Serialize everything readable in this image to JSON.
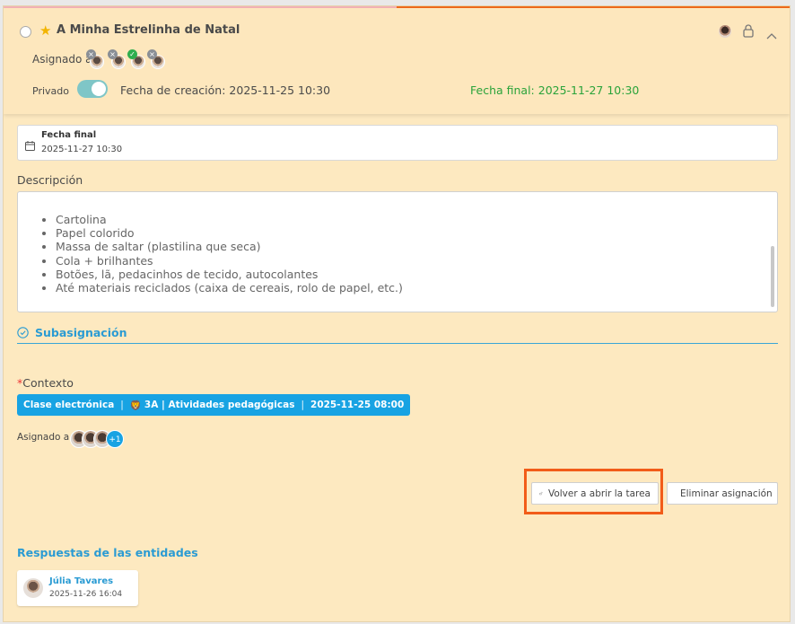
{
  "header": {
    "title": "A Minha Estrelinha de Natal",
    "assigned_label": "Asignado a",
    "private_label": "Privado",
    "created_text": "Fecha de creación: 2025-11-25 10:30",
    "final_text": "Fecha final: 2025-11-27 10:30",
    "private_on": true,
    "final_color": "#2aa33a"
  },
  "end_date_field": {
    "label": "Fecha final",
    "value": "2025-11-27 10:30"
  },
  "description": {
    "label": "Descripción",
    "items": [
      "Cartolina",
      "Papel colorido",
      "Massa de saltar (plastilina que seca)",
      "Cola + brilhantes",
      "Botões, lã, pedacinhos de tecido, autocolantes",
      "Até materiais reciclados (caixa de cereais, rolo de papel, etc.)"
    ]
  },
  "subassignment": {
    "label": "Subasignación"
  },
  "context": {
    "label": "Contexto",
    "required_mark": "*",
    "chip": {
      "class_type": "Clase electrónica",
      "group": "3A | Atividades pedagógicas",
      "datetime": "2025-11-25 08:00",
      "accent": "#18a3e3"
    }
  },
  "assigned2": {
    "label": "Asignado a",
    "more_count": "+1"
  },
  "actions": {
    "reopen_label": "Volver a abrir la tarea",
    "delete_label": "Eliminar asignación",
    "highlight_color": "#f25c19"
  },
  "responses": {
    "label": "Respuestas de las entidades",
    "items": [
      {
        "name": "Júlia Tavares",
        "time": "2025-11-26 16:04"
      }
    ]
  }
}
